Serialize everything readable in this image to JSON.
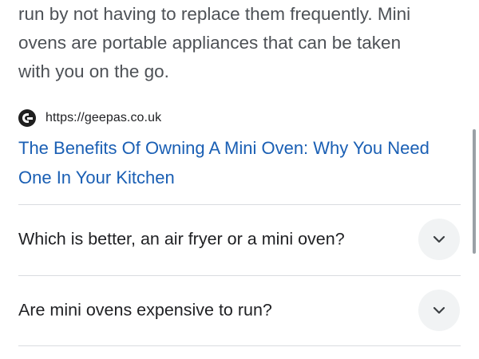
{
  "snippet": {
    "lines": [
      "run by not having to replace them frequently. Mini",
      "ovens are portable appliances that can be taken",
      "with you on the go."
    ]
  },
  "source": {
    "favicon": "geepas-g-logo-icon",
    "url": "https://geepas.co.uk"
  },
  "result": {
    "title_lines": [
      "The Benefits Of Owning A Mini Oven: Why You Need",
      "One In Your Kitchen"
    ]
  },
  "faq": [
    {
      "question": "Which is better, an air fryer or a mini oven?",
      "icon": "chevron-down-icon"
    },
    {
      "question": "Are mini ovens expensive to run?",
      "icon": "chevron-down-icon"
    }
  ],
  "colors": {
    "link": "#1a5fb4",
    "text": "#4d5156",
    "heading": "#202124",
    "divider": "#dadce0",
    "button_bg": "#f1f3f4"
  }
}
